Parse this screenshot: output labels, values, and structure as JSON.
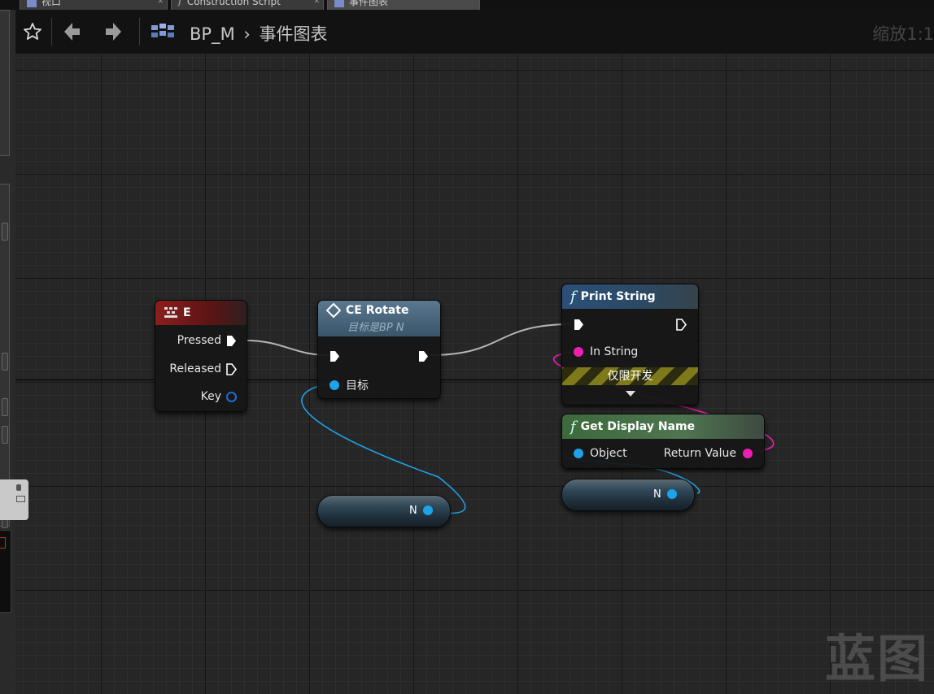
{
  "tabs": [
    {
      "label": "视口",
      "icon": "viewport-grid-icon"
    },
    {
      "label": "Construction Script",
      "icon": "function-icon"
    },
    {
      "label": "事件图表",
      "icon": "event-graph-icon"
    }
  ],
  "toolbar": {
    "blueprint_name": "BP_M",
    "separator": "›",
    "graph_name": "事件图表",
    "zoom": "缩放1:1"
  },
  "nodes": {
    "key_event": {
      "title": "E",
      "pins": {
        "pressed": "Pressed",
        "released": "Released",
        "key": "Key"
      }
    },
    "ce_rotate": {
      "title": "CE Rotate",
      "subtitle": "目标是BP N",
      "target_pin": "目标"
    },
    "print_string": {
      "title": "Print String",
      "in_string": "In String",
      "dev_only": "仅限开发"
    },
    "get_display_name": {
      "title": "Get Display Name",
      "object_pin": "Object",
      "return_pin": "Return Value"
    },
    "var_n_left": {
      "label": "N"
    },
    "var_n_right": {
      "label": "N"
    }
  },
  "watermark": "蓝图",
  "colors": {
    "exec_wire": "#bdbdbd",
    "object_wire": "#1ea2e8",
    "string_wire": "#ee1fb0",
    "event_header": "#8c1e1e",
    "function_header": "#2d4e78",
    "pure_function_header": "#3c6a3c"
  }
}
